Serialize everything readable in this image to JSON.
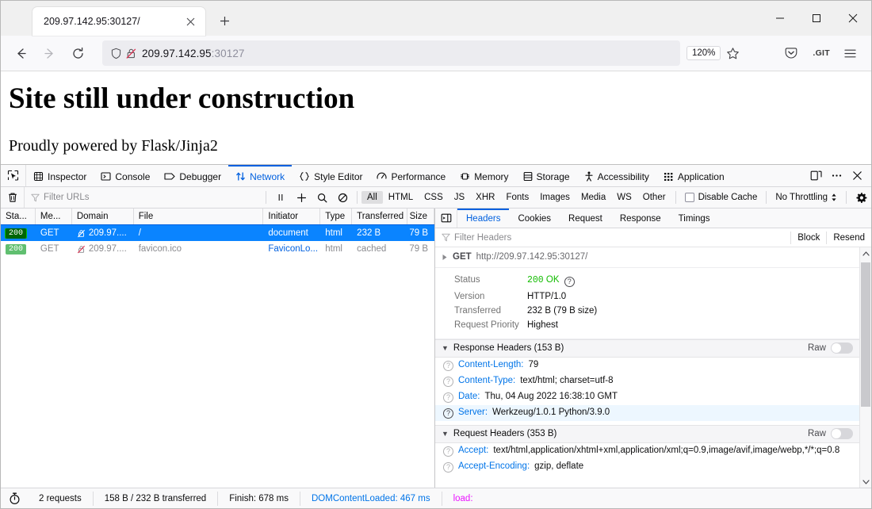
{
  "window": {
    "minimize_label": "Minimize",
    "maximize_label": "Maximize",
    "close_label": "Close"
  },
  "tab": {
    "title": "209.97.142.95:30127/",
    "close_label": "Close tab",
    "newtab_label": "New tab"
  },
  "nav": {
    "back_label": "Back",
    "forward_label": "Forward",
    "reload_label": "Reload",
    "url_host": "209.97.142.95",
    "url_port": ":30127",
    "zoom_level": "120%",
    "bookmark_label": "Bookmark this page",
    "pocket_label": "Save to Pocket",
    "extension_label": ".GIT",
    "menu_label": "Open application menu"
  },
  "page": {
    "heading": "Site still under construction",
    "paragraph": "Proudly powered by Flask/Jinja2"
  },
  "devtools": {
    "picker_label": "Pick an element",
    "tabs": [
      {
        "label": "Inspector",
        "icon": "inspector-icon",
        "active": false
      },
      {
        "label": "Console",
        "icon": "console-icon",
        "active": false
      },
      {
        "label": "Debugger",
        "icon": "debugger-icon",
        "active": false
      },
      {
        "label": "Network",
        "icon": "network-icon",
        "active": true
      },
      {
        "label": "Style Editor",
        "icon": "style-editor-icon",
        "active": false
      },
      {
        "label": "Performance",
        "icon": "performance-icon",
        "active": false
      },
      {
        "label": "Memory",
        "icon": "memory-icon",
        "active": false
      },
      {
        "label": "Storage",
        "icon": "storage-icon",
        "active": false
      },
      {
        "label": "Accessibility",
        "icon": "accessibility-icon",
        "active": false
      },
      {
        "label": "Application",
        "icon": "application-icon",
        "active": false
      }
    ],
    "responsive_label": "Responsive Design Mode",
    "meatball_label": "Customize Developer Tools",
    "close_label": "Close Developer Tools",
    "toolbar": {
      "clear_label": "Clear",
      "filter_placeholder": "Filter URLs",
      "pause_label": "Pause",
      "import_label": "Import HAR",
      "search_label": "Search",
      "block_label": "Block",
      "types": [
        "All",
        "HTML",
        "CSS",
        "JS",
        "XHR",
        "Fonts",
        "Images",
        "Media",
        "WS",
        "Other"
      ],
      "active_type": "All",
      "disable_cache_label": "Disable Cache",
      "disable_cache_checked": false,
      "throttling_value": "No Throttling",
      "settings_label": "Network Settings"
    },
    "table": {
      "columns": [
        "Sta...",
        "Me...",
        "Domain",
        "File",
        "Initiator",
        "Type",
        "Transferred",
        "Size"
      ],
      "rows": [
        {
          "status": "200",
          "method": "GET",
          "domain": "209.97....",
          "file": "/",
          "initiator": "document",
          "type": "html",
          "transferred": "232 B",
          "size": "79 B",
          "selected": true,
          "insecure_icon": "insecure-lock-icon"
        },
        {
          "status": "200",
          "method": "GET",
          "domain": "209.97....",
          "file": "favicon.ico",
          "initiator": "FaviconLo...",
          "type": "html",
          "transferred": "cached",
          "size": "79 B",
          "selected": false,
          "insecure_icon": "insecure-lock-icon"
        }
      ]
    },
    "details": {
      "sidebar_toggle_label": "Toggle request details",
      "tabs": [
        "Headers",
        "Cookies",
        "Request",
        "Response",
        "Timings"
      ],
      "active_tab": "Headers",
      "filter_placeholder": "Filter Headers",
      "block_label": "Block",
      "resend_label": "Resend",
      "request_line": {
        "method": "GET",
        "url": "http://209.97.142.95:30127/"
      },
      "summary": [
        {
          "key": "Status",
          "value": "200 OK",
          "status_code": "200",
          "status_text": "OK"
        },
        {
          "key": "Version",
          "value": "HTTP/1.0"
        },
        {
          "key": "Transferred",
          "value": "232 B (79 B size)"
        },
        {
          "key": "Request Priority",
          "value": "Highest"
        }
      ],
      "response_headers": {
        "title": "Response Headers (153 B)",
        "raw_label": "Raw",
        "raw_enabled": false,
        "items": [
          {
            "name": "Content-Length:",
            "value": "79",
            "highlighted": false
          },
          {
            "name": "Content-Type:",
            "value": "text/html; charset=utf-8",
            "highlighted": false
          },
          {
            "name": "Date:",
            "value": "Thu, 04 Aug 2022 16:38:10 GMT",
            "highlighted": false
          },
          {
            "name": "Server:",
            "value": "Werkzeug/1.0.1 Python/3.9.0",
            "highlighted": true
          }
        ]
      },
      "request_headers": {
        "title": "Request Headers (353 B)",
        "raw_label": "Raw",
        "raw_enabled": false,
        "items": [
          {
            "name": "Accept:",
            "value": "text/html,application/xhtml+xml,application/xml;q=0.9,image/avif,image/webp,*/*;q=0.8",
            "highlighted": false
          },
          {
            "name": "Accept-Encoding:",
            "value": "gzip, deflate",
            "highlighted": false
          }
        ]
      }
    },
    "statusbar": {
      "timer_icon": "stopwatch-icon",
      "requests": "2 requests",
      "transferred": "158 B / 232 B transferred",
      "finish": "Finish: 678 ms",
      "domcontentloaded": "DOMContentLoaded: 467 ms",
      "load": "load:"
    }
  },
  "colors": {
    "accent_blue": "#0060df",
    "selection_blue": "#0a84ff",
    "status_green": "#12bc00",
    "badge_dark_green": "#006504",
    "badge_light_green": "#60bf70",
    "header_name_blue": "#0074e8",
    "load_magenta": "#ea14ff"
  }
}
